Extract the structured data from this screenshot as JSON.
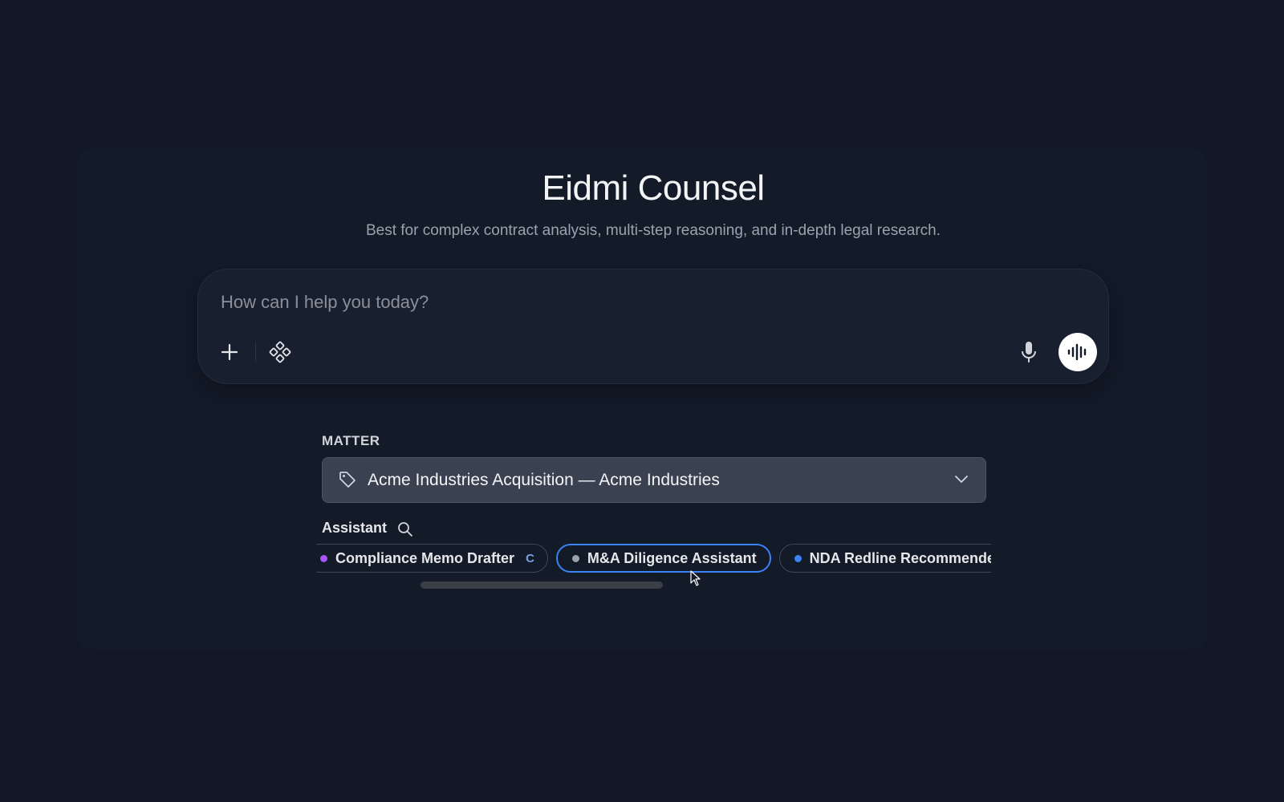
{
  "app": {
    "title": "Eidmi Counsel",
    "subtitle": "Best for complex contract analysis, multi-step reasoning, and in-depth legal research."
  },
  "composer": {
    "placeholder": "How can I help you today?",
    "value": "",
    "icons": {
      "add": "plus-icon",
      "tools": "tools-icon",
      "mic": "microphone-icon",
      "voice": "voice-waveform-icon"
    }
  },
  "matter": {
    "label": "MATTER",
    "selected": "Acme Industries Acquisition — Acme Industries",
    "icon": "tag-icon"
  },
  "assistant": {
    "label": "Assistant",
    "chips": [
      {
        "label": "Compliance Memo Drafter",
        "dot_color": "#a855f7",
        "badge": "C",
        "selected": false
      },
      {
        "label": "M&A Diligence Assistant",
        "dot_color": "#9ca3af",
        "badge": "",
        "selected": true
      },
      {
        "label": "NDA Redline Recommender",
        "dot_color": "#3b82f6",
        "badge": "",
        "selected": false
      }
    ]
  },
  "colors": {
    "background": "#121826",
    "accent": "#3b82f6",
    "select_bg": "#3a4252"
  }
}
